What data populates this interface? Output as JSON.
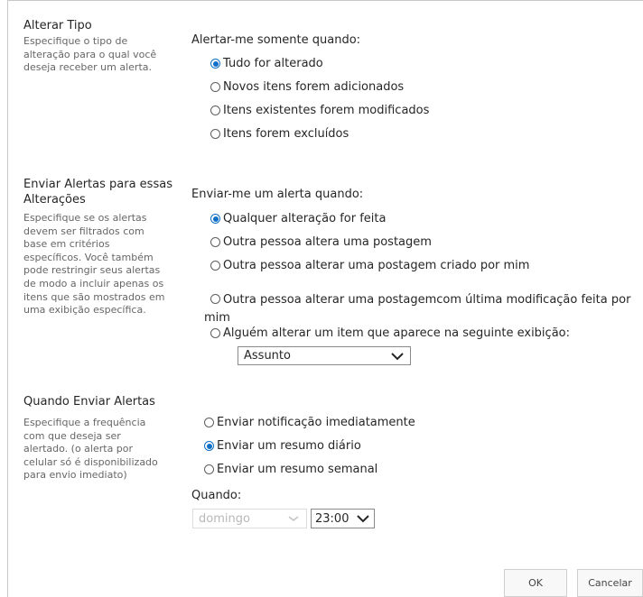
{
  "change_type": {
    "title": "Alterar Tipo",
    "description": "Especifique o tipo de alteração para o qual você deseja receber um alerta.",
    "group_label": "Alertar-me somente quando:",
    "options": [
      {
        "label": "Tudo for alterado",
        "checked": true
      },
      {
        "label": "Novos itens forem adicionados",
        "checked": false
      },
      {
        "label": "Itens existentes forem modificados",
        "checked": false
      },
      {
        "label": "Itens forem excluídos",
        "checked": false
      }
    ]
  },
  "filter": {
    "title": "Enviar Alertas para essas Alterações",
    "description": "Especifique se os alertas devem ser filtrados com base em critérios específicos. Você também pode restringir seus alertas de modo a incluir apenas os itens que são mostrados em uma exibição específica.",
    "group_label": "Enviar-me um alerta quando:",
    "options": [
      {
        "label": "Qualquer alteração for feita",
        "checked": true
      },
      {
        "label": "Outra pessoa altera uma postagem",
        "checked": false
      },
      {
        "label": "Outra pessoa alterar uma postagem criado por mim",
        "checked": false
      },
      {
        "label": "Outra pessoa alterar uma postagemcom última modificação feita por mim",
        "checked": false
      },
      {
        "label": "Alguém alterar um item que aparece na seguinte exibição:",
        "checked": false
      }
    ],
    "view_select": "Assunto"
  },
  "when_send": {
    "title": "Quando Enviar Alertas",
    "description": "Especifique a frequência com que deseja ser alertado. (o alerta por celular só é disponibilizado para envio imediato)",
    "options": [
      {
        "label": "Enviar notificação imediatamente",
        "checked": false
      },
      {
        "label": "Enviar um resumo diário",
        "checked": true
      },
      {
        "label": "Enviar um resumo semanal",
        "checked": false
      }
    ],
    "when_label": "Quando:",
    "day_select": "domingo",
    "time_select": "23:00"
  },
  "buttons": {
    "ok": "OK",
    "cancel": "Cancelar"
  },
  "colors": {
    "accent": "#0f6fc6",
    "text": "#262626",
    "muted": "#666666"
  }
}
